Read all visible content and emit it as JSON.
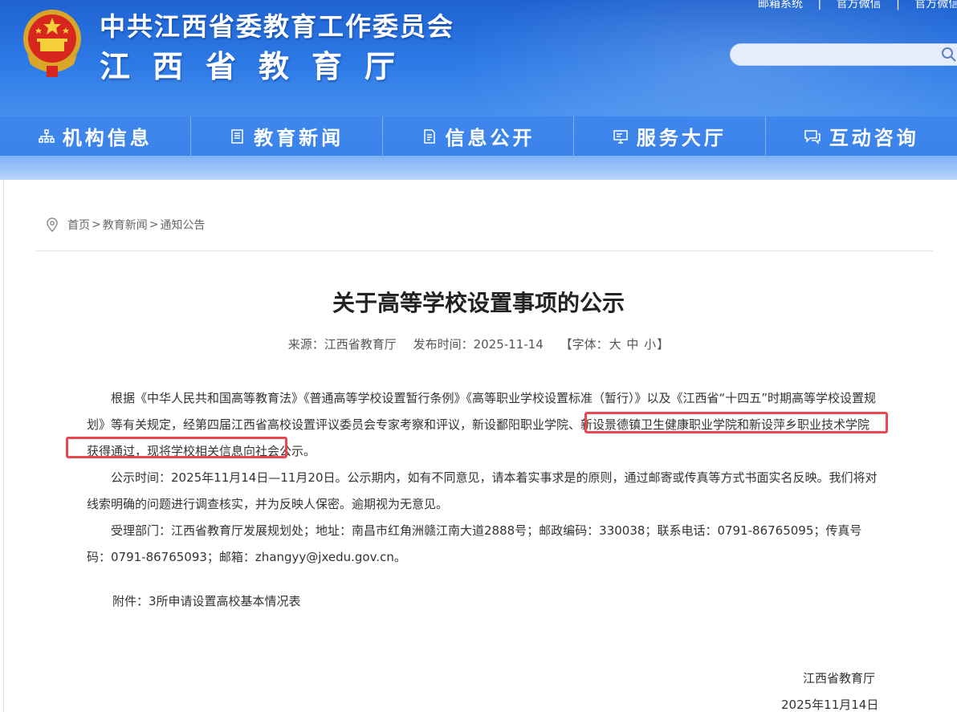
{
  "header": {
    "title_line1": "中共江西省委教育工作委员会",
    "title_line2": "江西省教育厅",
    "links": [
      "邮箱系统",
      "官方微信",
      "官方微信"
    ],
    "search_placeholder": ""
  },
  "nav": {
    "items": [
      {
        "label": "机构信息",
        "icon": "org-chart-icon"
      },
      {
        "label": "教育新闻",
        "icon": "news-icon"
      },
      {
        "label": "信息公开",
        "icon": "document-icon"
      },
      {
        "label": "服务大厅",
        "icon": "monitor-icon"
      },
      {
        "label": "互动咨询",
        "icon": "chat-icon"
      }
    ]
  },
  "breadcrumb": {
    "items": [
      "首页",
      "教育新闻",
      "通知公告"
    ],
    "separator": ">"
  },
  "article": {
    "title": "关于高等学校设置事项的公示",
    "source": "来源：江西省教育厅",
    "date": "发布时间：2025-11-14",
    "font_prefix": "【字体：",
    "font_large": "大",
    "font_medium": "中",
    "font_small": "小",
    "font_suffix": "】",
    "p1_a": "根据《中华人民共和国高等教育法》《普通高等学校设置暂行条例》《高等职业学校设置标准（暂行）》以及《江西省“十四五”时期高等学校设置规划》等有关规定，经第四届江西省高校设置评议委员会专家考察和评议，",
    "p1_b": "新设鄱阳职业学院、新设景德镇卫生健康职业学院和新设萍乡职业技术学院获得通过",
    "p1_c": "，现将学校相关信息向社会公示。",
    "p2": "公示时间：2025年11月14日—11月20日。公示期内，如有不同意见，请本着实事求是的原则，通过邮寄或传真等方式书面实名反映。我们将对线索明确的问题进行调查核实，并为反映人保密。逾期视为无意见。",
    "p3": "受理部门：江西省教育厅发展规划处；地址：南昌市红角洲赣江南大道2888号；邮政编码：330038；联系电话：0791-86765095；传真号码：0791-86765093；邮箱：zhangyy@jxedu.gov.cn。",
    "attachment_label": "附件：",
    "attachment_link": "3所申请设置高校基本情况表",
    "sign_org": "江西省教育厅",
    "sign_date": "2025年11月14日"
  },
  "colors": {
    "header_blue": "#2d7ae6",
    "nav_blue": "#3b83ea",
    "highlight_red": "#e8484f"
  }
}
